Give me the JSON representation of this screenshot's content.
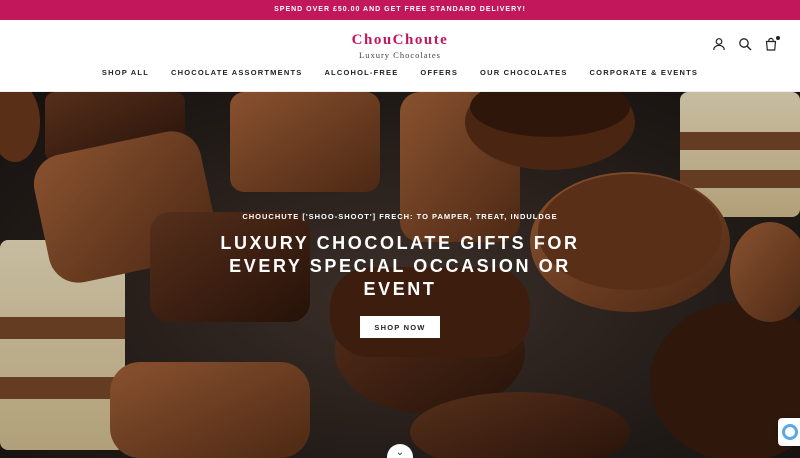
{
  "announcement": "SPEND OVER £50.00 AND GET FREE STANDARD DELIVERY!",
  "brand": {
    "name": "ChouChoute",
    "tagline": "Luxury Chocolates",
    "color": "#c2185b"
  },
  "header_icons": [
    "account-icon",
    "search-icon",
    "cart-icon"
  ],
  "nav": [
    "SHOP ALL",
    "CHOCOLATE ASSORTMENTS",
    "ALCOHOL-FREE",
    "OFFERS",
    "OUR CHOCOLATES",
    "CORPORATE & EVENTS"
  ],
  "hero": {
    "eyebrow": "CHOUCHUTE ['SHOO-SHOOT'] FRECH: TO PAMPER, TREAT, INDULDGE",
    "title": "LUXURY CHOCOLATE GIFTS FOR EVERY SPECIAL OCCASION OR EVENT",
    "cta": "SHOP NOW",
    "scroll_icon": "chevron-down-icon"
  }
}
